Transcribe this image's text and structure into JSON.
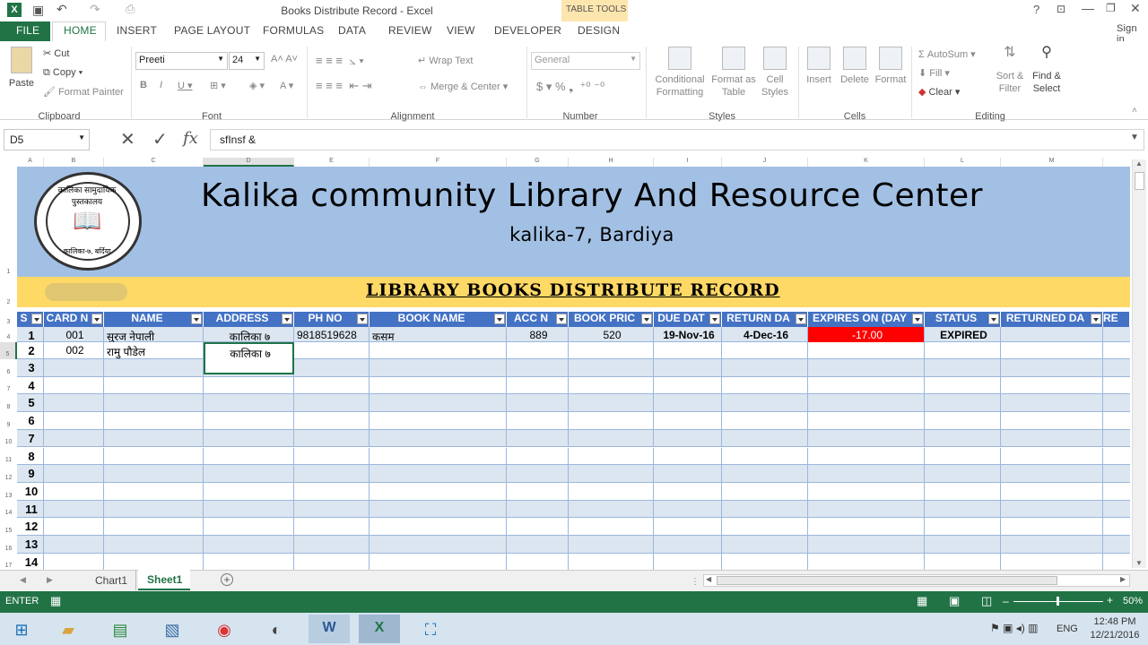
{
  "app": {
    "window_title": "Books Distribute Record - Excel",
    "table_tools": "TABLE TOOLS",
    "help": "?",
    "sign_in": "Sign in"
  },
  "tabs": [
    "FILE",
    "HOME",
    "INSERT",
    "PAGE LAYOUT",
    "FORMULAS",
    "DATA",
    "REVIEW",
    "VIEW",
    "DEVELOPER",
    "DESIGN"
  ],
  "ribbon": {
    "clipboard": {
      "paste": "Paste",
      "cut": "Cut",
      "copy": "Copy",
      "format_painter": "Format Painter",
      "group": "Clipboard"
    },
    "font": {
      "name": "Preeti",
      "size": "24",
      "group": "Font"
    },
    "alignment": {
      "wrap": "Wrap Text",
      "merge": "Merge & Center",
      "group": "Alignment"
    },
    "number": {
      "format": "General",
      "group": "Number"
    },
    "styles": {
      "cond": "Conditional Formatting",
      "fmt_table": "Format as Table",
      "cell_styles": "Cell Styles",
      "group": "Styles"
    },
    "cells": {
      "insert": "Insert",
      "delete": "Delete",
      "format": "Format",
      "group": "Cells"
    },
    "editing": {
      "autosum": "AutoSum",
      "fill": "Fill",
      "clear": "Clear",
      "sort": "Sort & Filter",
      "find": "Find & Select",
      "group": "Editing"
    }
  },
  "formula_bar": {
    "name_box": "D5",
    "formula": "sfInsf &"
  },
  "columns": [
    "A",
    "B",
    "C",
    "D",
    "E",
    "F",
    "G",
    "H",
    "I",
    "J",
    "K",
    "L",
    "M"
  ],
  "sheet": {
    "title": "Kalika community Library And Resource Center",
    "subtitle": "kalika-7, Bardiya",
    "record_title": "LIBRARY BOOKS DISTRIBUTE RECORD",
    "logo_text": "कालिका सामुदायिक पुस्तकालय",
    "logo_bottom": "कालिका-७, बर्दिया",
    "headers": [
      "S",
      "CARD N",
      "NAME",
      "ADDRESS",
      "PH NO",
      "BOOK NAME",
      "ACC N",
      "BOOK PRIC",
      "DUE DAT",
      "RETURN DA",
      "EXPIRES ON (DAY",
      "STATUS",
      "RETURNED DA",
      "RE"
    ],
    "rows": [
      {
        "sn": "1",
        "card": "001",
        "name": "सुरज नेपाली",
        "address": "कालिका ७",
        "phone": "9818519628",
        "book": "कसम",
        "acc": "889",
        "price": "520",
        "due": "19-Nov-16",
        "return": "4-Dec-16",
        "expires": "-17.00",
        "status": "EXPIRED"
      },
      {
        "sn": "2",
        "card": "002",
        "name": "रामु पौडेल",
        "address": "कालिका ७",
        "phone": "",
        "book": "",
        "acc": "",
        "price": "",
        "due": "",
        "return": "",
        "expires": "",
        "status": ""
      },
      {
        "sn": "3"
      },
      {
        "sn": "4"
      },
      {
        "sn": "5"
      },
      {
        "sn": "6"
      },
      {
        "sn": "7"
      },
      {
        "sn": "8"
      },
      {
        "sn": "9"
      },
      {
        "sn": "10"
      },
      {
        "sn": "11"
      },
      {
        "sn": "12"
      },
      {
        "sn": "13"
      },
      {
        "sn": "14"
      }
    ]
  },
  "sheet_tabs": [
    "Chart1",
    "Sheet1"
  ],
  "status": {
    "mode": "ENTER",
    "zoom": "50%"
  },
  "taskbar": {
    "lang": "ENG",
    "time": "12:48 PM",
    "date": "12/21/2016"
  },
  "colors": {
    "excel_green": "#217346",
    "header_blue": "#4472c4",
    "banner_blue": "#a2c0e4",
    "banner_yellow": "#ffd966",
    "expired_red": "#ff0000"
  }
}
